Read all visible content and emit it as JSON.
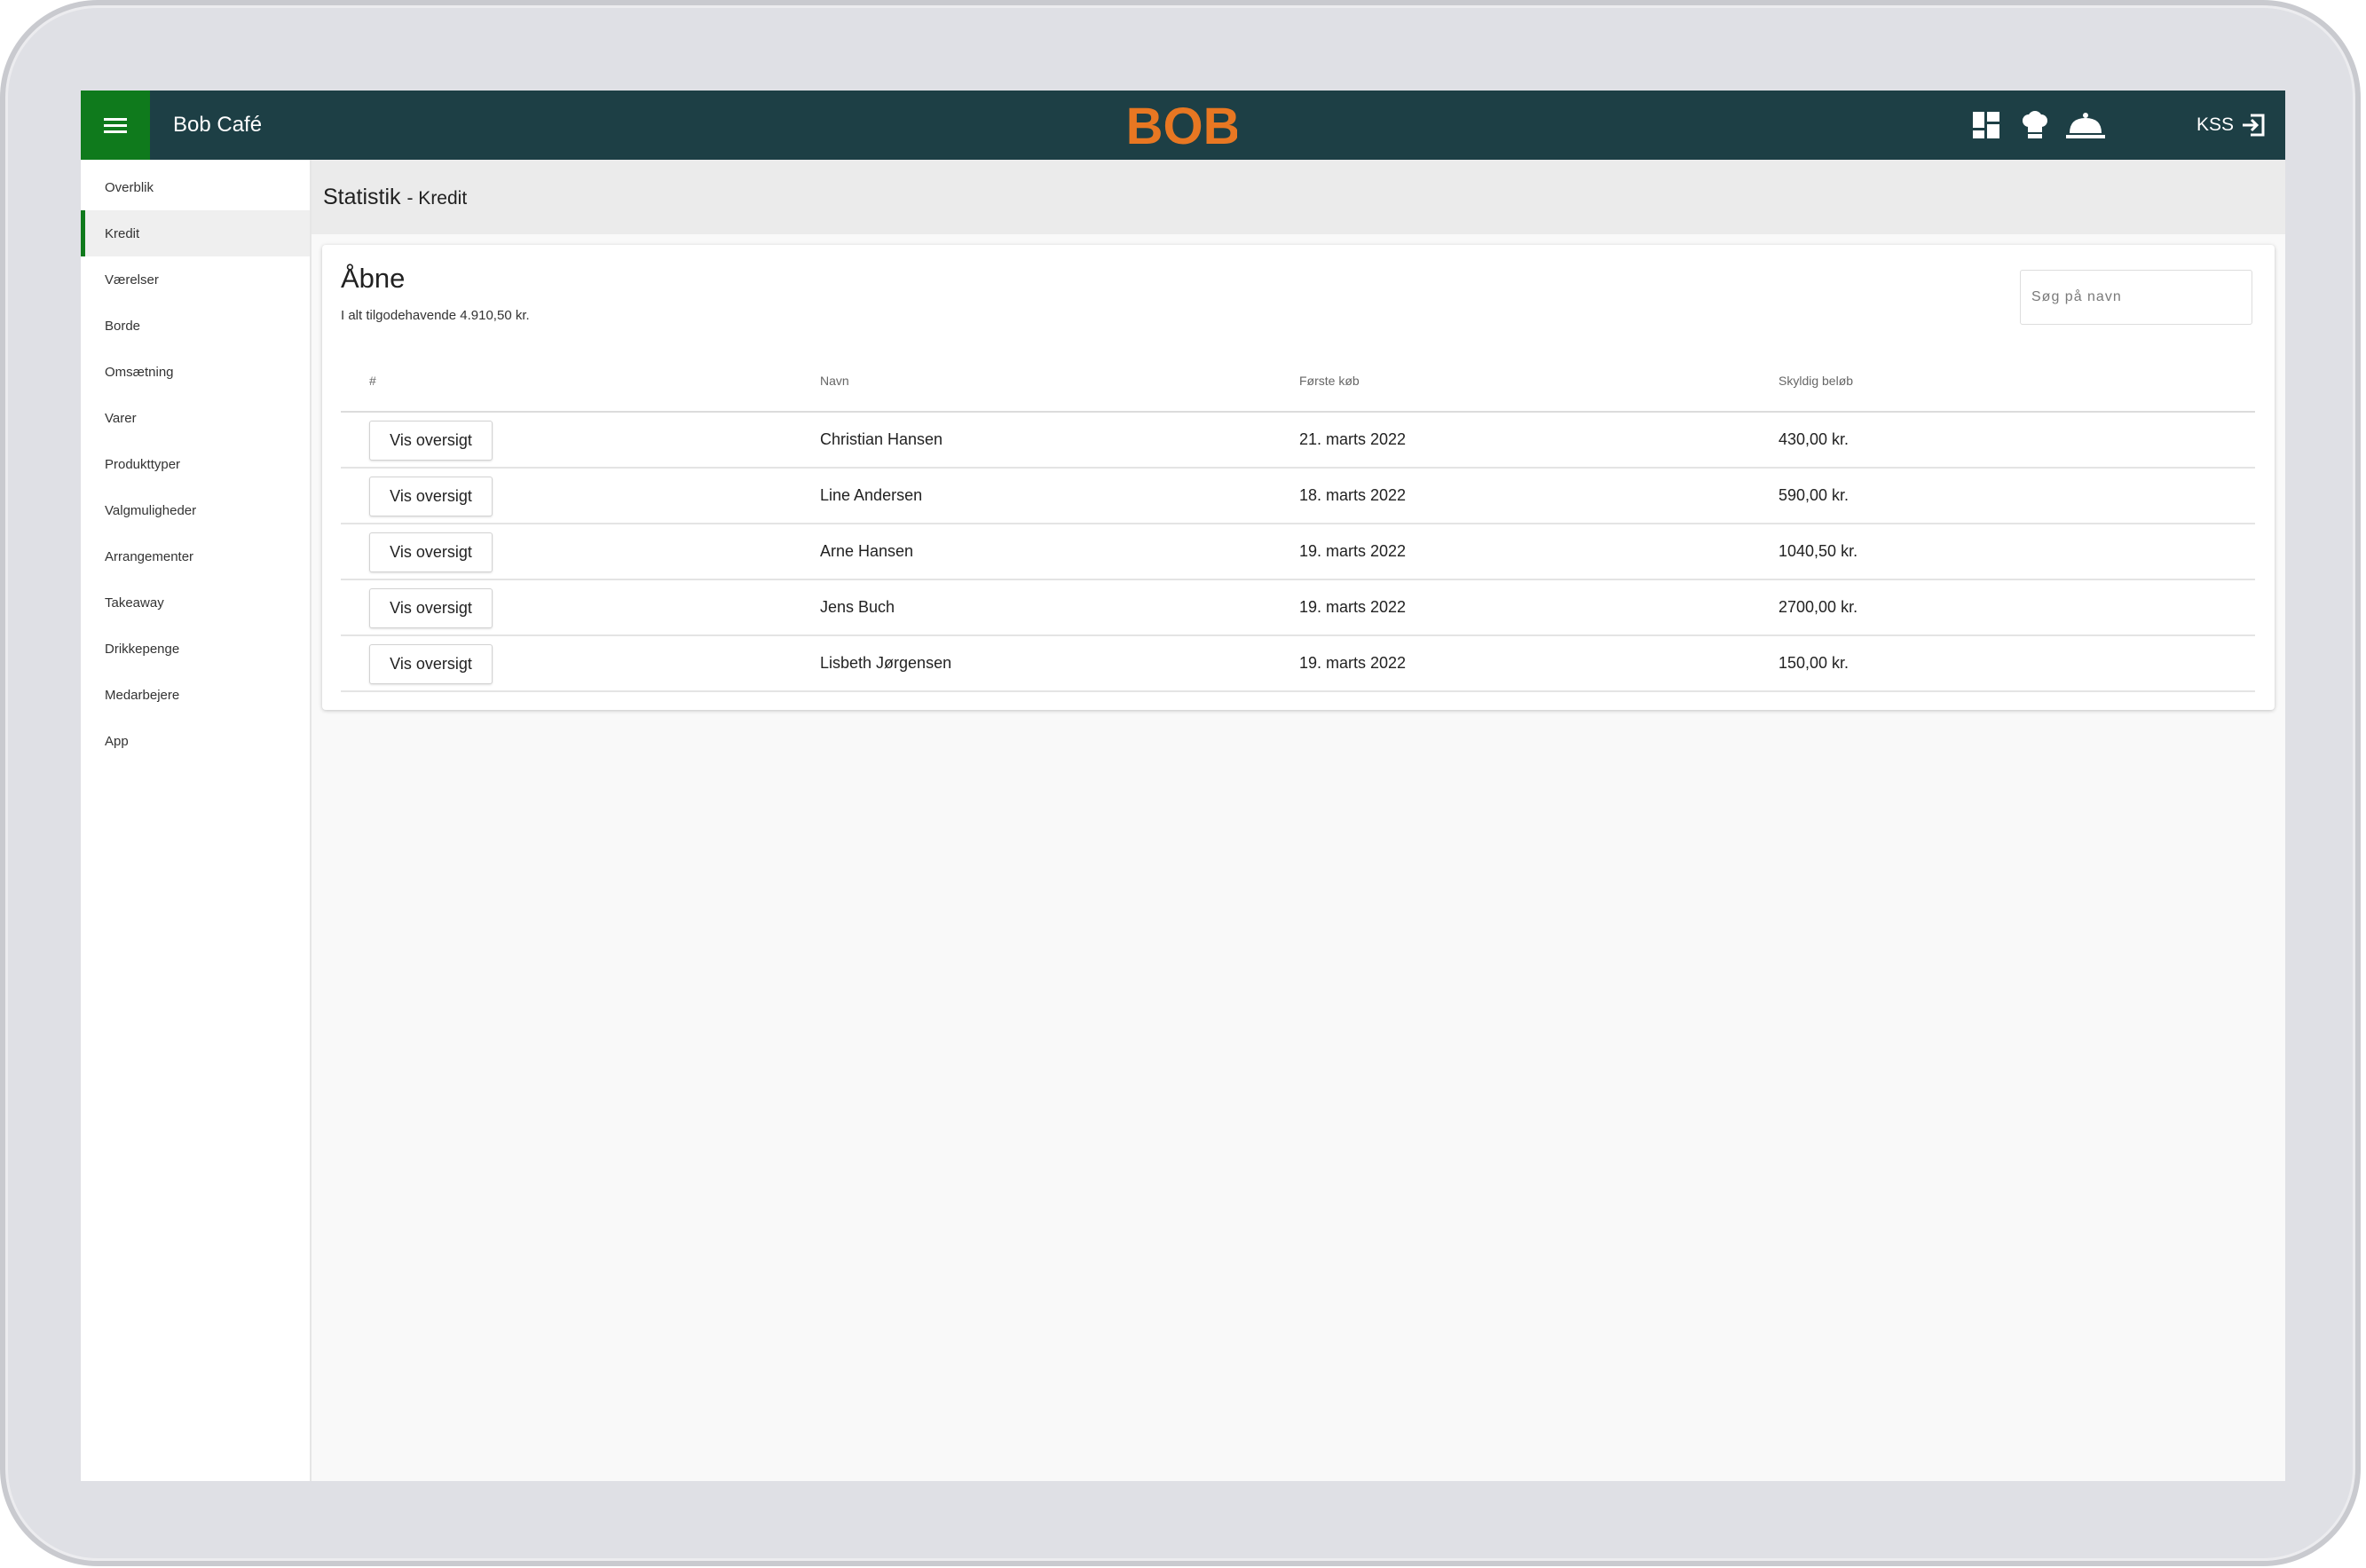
{
  "app": {
    "title": "Bob Café",
    "logo_text": "BOB",
    "brand_color": "#e87722",
    "topbar_color": "#1d3f45",
    "accent_color": "#0f7a1c"
  },
  "topbar": {
    "icons": [
      "dashboard-icon",
      "chef-hat-icon",
      "cloche-icon"
    ],
    "user_label": "KSS",
    "logout_icon": "logout-icon"
  },
  "sidebar": {
    "items": [
      {
        "label": "Overblik",
        "active": false
      },
      {
        "label": "Kredit",
        "active": true
      },
      {
        "label": "Værelser",
        "active": false
      },
      {
        "label": "Borde",
        "active": false
      },
      {
        "label": "Omsætning",
        "active": false
      },
      {
        "label": "Varer",
        "active": false
      },
      {
        "label": "Produkttyper",
        "active": false
      },
      {
        "label": "Valgmuligheder",
        "active": false
      },
      {
        "label": "Arrangementer",
        "active": false
      },
      {
        "label": "Takeaway",
        "active": false
      },
      {
        "label": "Drikkepenge",
        "active": false
      },
      {
        "label": "Medarbejere",
        "active": false
      },
      {
        "label": "App",
        "active": false
      }
    ]
  },
  "page": {
    "title": "Statistik",
    "subtitle": "- Kredit"
  },
  "card": {
    "title": "Åbne",
    "summary": "I alt tilgodehavende 4.910,50 kr.",
    "search_placeholder": "Søg på navn"
  },
  "table": {
    "headers": [
      "#",
      "Navn",
      "Første køb",
      "Skyldig beløb"
    ],
    "button_label": "Vis oversigt",
    "rows": [
      {
        "name": "Christian Hansen",
        "first_purchase": "21. marts 2022",
        "amount": "430,00 kr."
      },
      {
        "name": "Line Andersen",
        "first_purchase": "18. marts 2022",
        "amount": "590,00 kr."
      },
      {
        "name": "Arne Hansen",
        "first_purchase": "19. marts 2022",
        "amount": "1040,50 kr."
      },
      {
        "name": "Jens Buch",
        "first_purchase": "19. marts 2022",
        "amount": "2700,00 kr."
      },
      {
        "name": "Lisbeth Jørgensen",
        "first_purchase": "19. marts 2022",
        "amount": "150,00 kr."
      }
    ]
  }
}
